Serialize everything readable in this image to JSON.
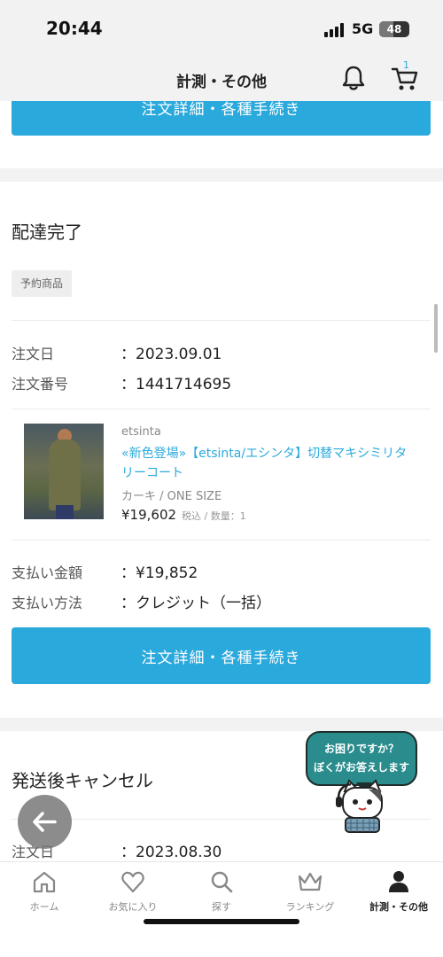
{
  "status_bar": {
    "time": "20:44",
    "network": "5G",
    "battery": "48",
    "battery_level": 0.48
  },
  "header": {
    "title": "計測・その他",
    "cart_count": "1"
  },
  "top_button_label": "注文詳細・各種手続き",
  "order1": {
    "status": "配達完了",
    "tag": "予約商品",
    "order_date_label": "注文日",
    "order_date_value": "：2023.09.01",
    "order_no_label": "注文番号",
    "order_no_value": "：1441714695",
    "product": {
      "brand": "etsinta",
      "name": "«新色登場»【etsinta/エシンタ】切替マキシミリタリーコート",
      "variant": "カーキ / ONE SIZE",
      "price": "¥19,602",
      "price_note": "税込 / 数量：1"
    },
    "payment_amount_label": "支払い金額",
    "payment_amount_value": "：¥19,852",
    "payment_method_label": "支払い方法",
    "payment_method_value": "：クレジット（一括）",
    "button_label": "注文詳細・各種手続き"
  },
  "order2": {
    "status": "発送後キャンセル",
    "order_date_label": "注文日",
    "order_date_value": "：2023.08.30"
  },
  "help_bubble": {
    "line1": "お困りですか？",
    "line2": "ぼくがお答えします"
  },
  "tabbar": {
    "items": [
      {
        "label": "ホーム",
        "icon": "home-icon"
      },
      {
        "label": "お気に入り",
        "icon": "heart-icon"
      },
      {
        "label": "探す",
        "icon": "search-icon"
      },
      {
        "label": "ランキング",
        "icon": "crown-icon"
      },
      {
        "label": "計測・その他",
        "icon": "person-icon"
      }
    ],
    "active_index": 4
  },
  "colors": {
    "accent": "#2aa9dd",
    "help_bubble": "#2a8c8c"
  }
}
